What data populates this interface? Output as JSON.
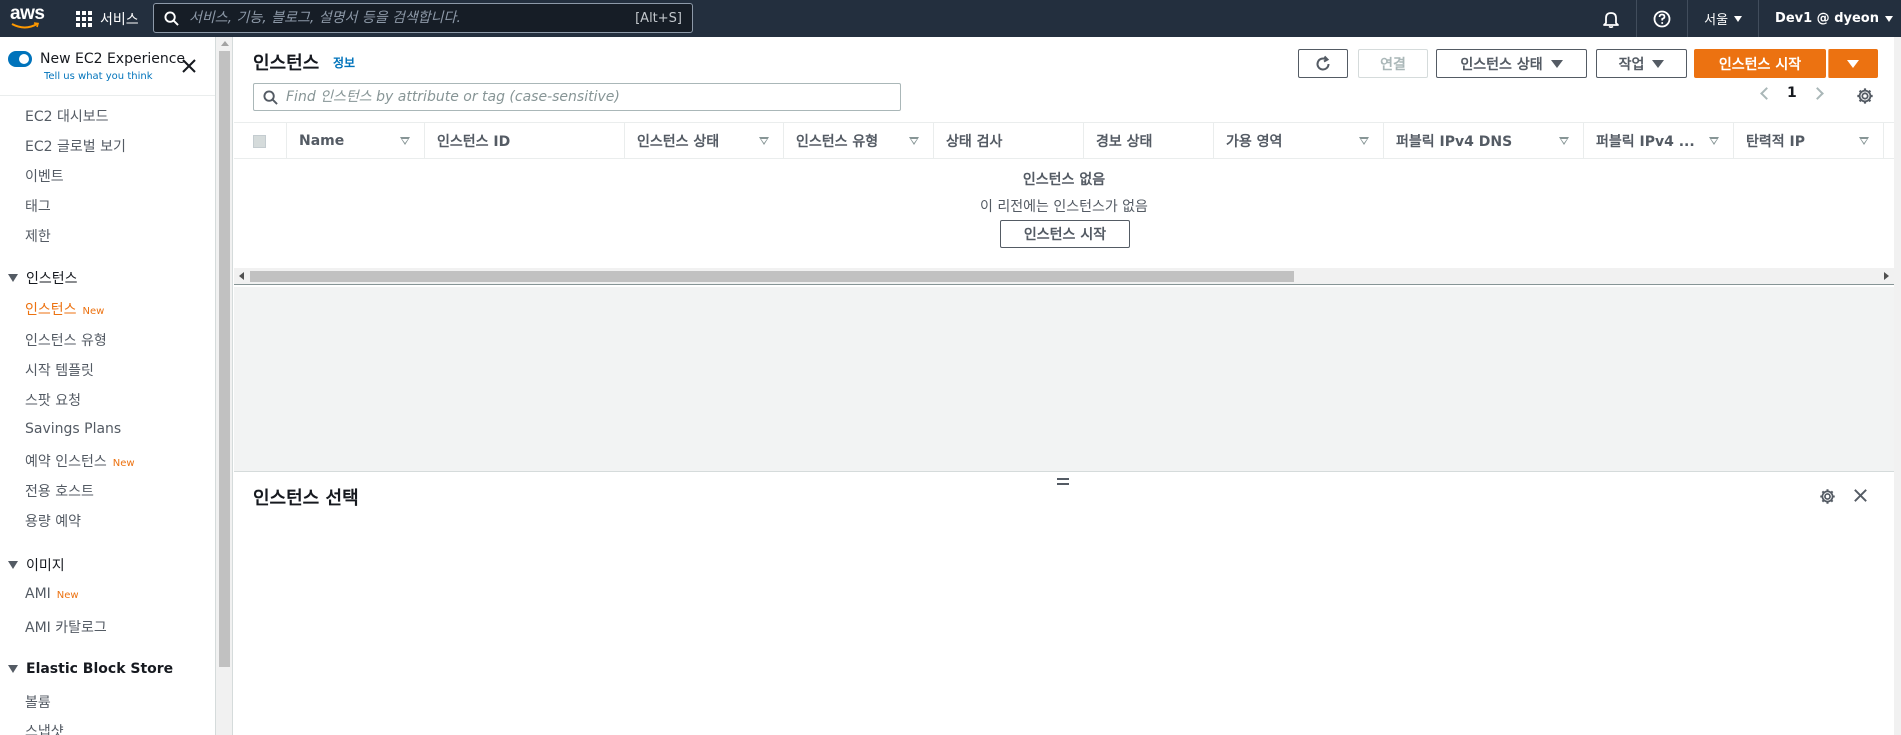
{
  "topnav": {
    "logo_text": "aws",
    "services_label": "서비스",
    "search_placeholder": "서비스, 기능, 블로그, 설명서 등을 검색합니다.",
    "search_shortcut": "[Alt+S]",
    "region_label": "서울",
    "account_label": "Dev1 @ dyeon",
    "icons": [
      "menu-grid-icon",
      "search-icon",
      "bell-icon",
      "help-icon"
    ]
  },
  "sidebar": {
    "toggle_label": "New EC2 Experience",
    "feedback_link": "Tell us what you think",
    "items": [
      {
        "label": "EC2 대시보드"
      },
      {
        "label": "EC2 글로벌 보기"
      },
      {
        "label": "이벤트"
      },
      {
        "label": "태그"
      },
      {
        "label": "제한"
      }
    ],
    "sections": [
      {
        "title": "인스턴스",
        "items": [
          {
            "label": "인스턴스",
            "badge": "New",
            "active": true
          },
          {
            "label": "인스턴스 유형"
          },
          {
            "label": "시작 템플릿"
          },
          {
            "label": "스팟 요청"
          },
          {
            "label": "Savings Plans"
          },
          {
            "label": "예약 인스턴스",
            "badge": "New"
          },
          {
            "label": "전용 호스트"
          },
          {
            "label": "용량 예약"
          }
        ]
      },
      {
        "title": "이미지",
        "items": [
          {
            "label": "AMI",
            "badge": "New"
          },
          {
            "label": "AMI 카탈로그"
          }
        ]
      },
      {
        "title": "Elastic Block Store",
        "items": [
          {
            "label": "볼륨"
          },
          {
            "label": "스냅샷"
          }
        ]
      }
    ]
  },
  "main": {
    "title": "인스턴스",
    "info_link": "정보",
    "buttons": {
      "connect": "연결",
      "instance_state": "인스턴스 상태",
      "actions": "작업",
      "launch": "인스턴스 시작"
    },
    "filter_placeholder": "Find 인스턴스 by attribute or tag (case-sensitive)",
    "page_number": "1",
    "columns": [
      "Name",
      "인스턴스 ID",
      "인스턴스 상태",
      "인스턴스 유형",
      "상태 검사",
      "경보 상태",
      "가용 영역",
      "퍼블릭 IPv4 DNS",
      "퍼블릭 IPv4 ...",
      "탄력적 IP"
    ],
    "empty_title": "인스턴스 없음",
    "empty_sub": "이 리전에는 인스턴스가 없음",
    "empty_button": "인스턴스 시작"
  },
  "detail": {
    "title": "인스턴스 선택"
  },
  "colors": {
    "nav_bg": "#232f3e",
    "accent_orange": "#ec7211",
    "link_blue": "#0073bb"
  }
}
